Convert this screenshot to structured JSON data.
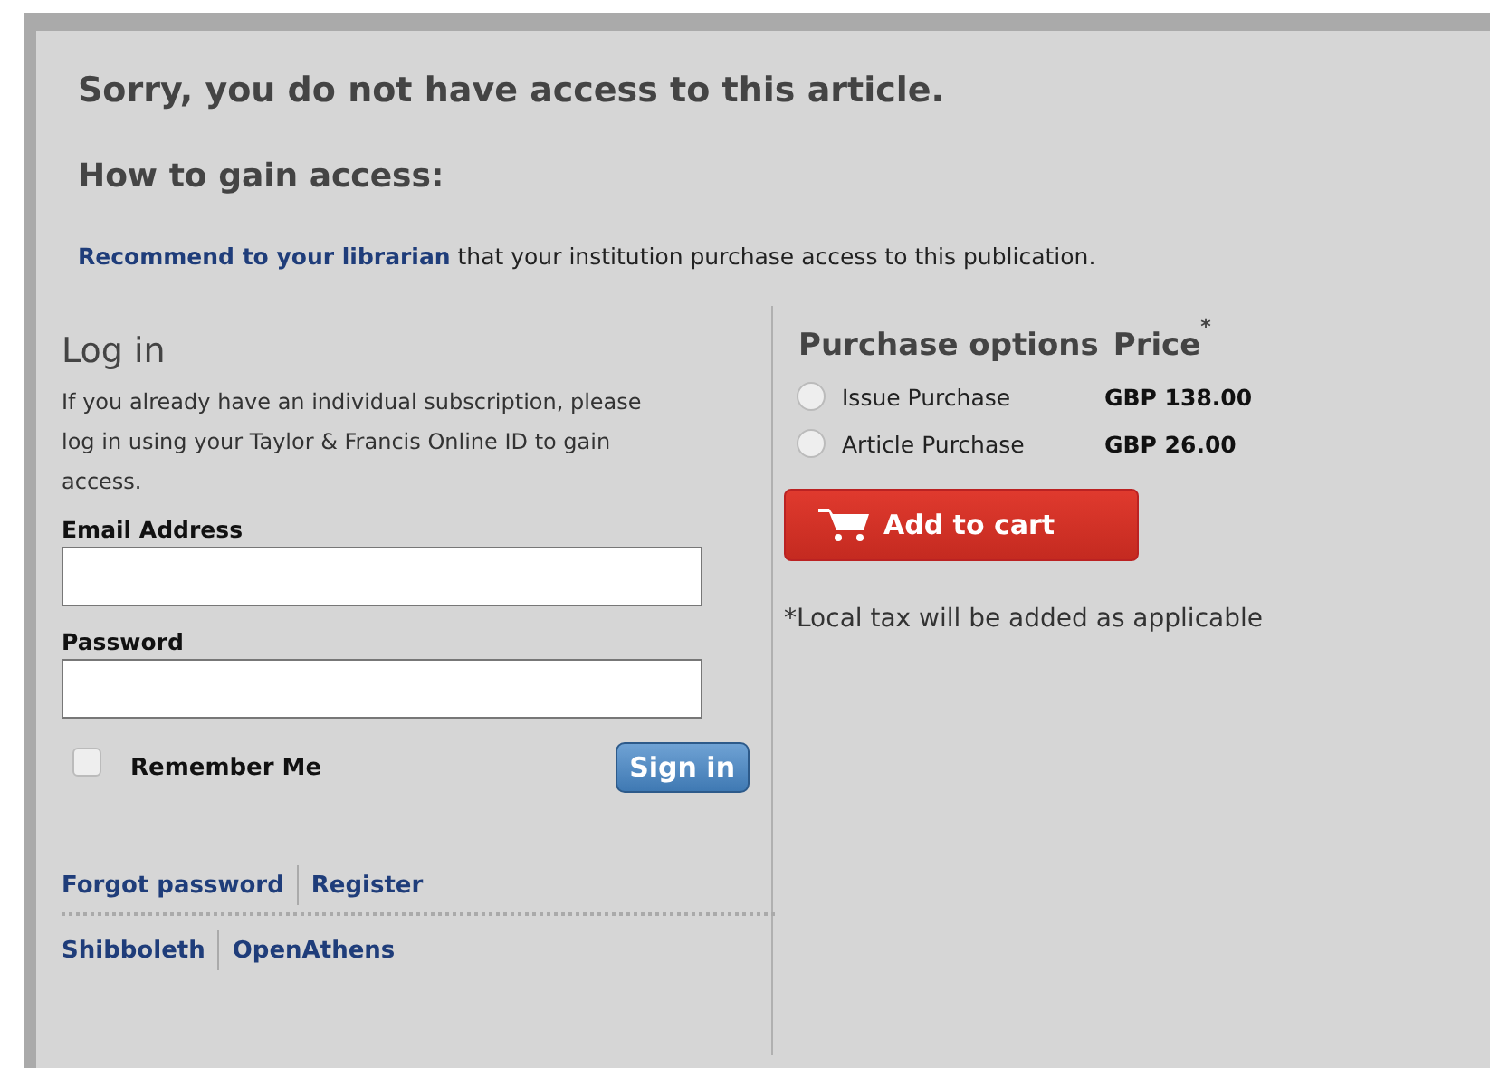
{
  "heading": "Sorry, you do not have access to this article.",
  "subheading": "How to gain access:",
  "recommend": {
    "link": "Recommend to your librarian",
    "text": " that your institution purchase access to this publication."
  },
  "login": {
    "title": "Log in",
    "intro": "If you already have an individual subscription, please log in using your Taylor & Francis Online ID to gain access.",
    "fields": [
      {
        "label": "Email Address"
      },
      {
        "label": "Password"
      }
    ],
    "remember": {
      "label": "Remember Me",
      "checked": false
    },
    "sign_in": "Sign in",
    "links": [
      [
        "Forgot password",
        "Register"
      ],
      [
        "Shibboleth",
        "OpenAthens"
      ]
    ]
  },
  "purchase": {
    "column_headers": [
      "Purchase options",
      "Price$^{*}$"
    ],
    "options": [
      {
        "label": "Issue Purchase",
        "price": "GBP 138.00",
        "selected": false
      },
      {
        "label": "Article Purchase",
        "price": "GBP 26.00",
        "selected": false
      }
    ],
    "button": "Add to cart",
    "note": "*Local tax will be added as applicable"
  }
}
